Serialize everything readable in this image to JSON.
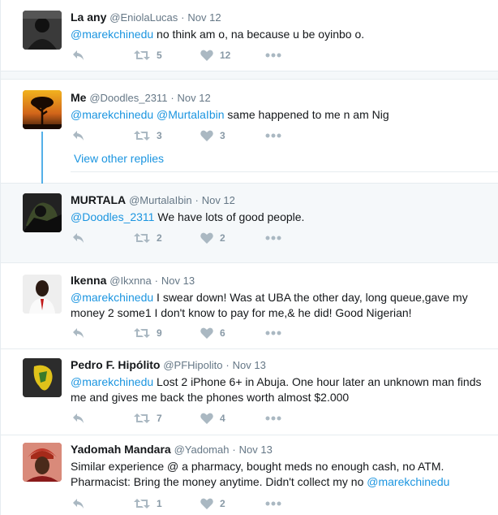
{
  "tweets": [
    {
      "name": "La any",
      "handle": "@EniolaLucas",
      "time": "Nov 12",
      "mention": "@marekchinedu",
      "text": " no think am o, na because u be oyinbo o.",
      "retweets": "5",
      "likes": "12"
    },
    {
      "name": "Me",
      "handle": "@Doodles_2311",
      "time": "Nov 12",
      "mention": "@marekchinedu @MurtalaIbin",
      "text": " same happened to me n am Nig",
      "retweets": "3",
      "likes": "3"
    },
    {
      "name": "MURTALA",
      "handle": "@MurtalaIbin",
      "time": "Nov 12",
      "mention": "@Doodles_2311",
      "text": " We have lots of good people.",
      "retweets": "2",
      "likes": "2"
    },
    {
      "name": "Ikenna",
      "handle": "@Ikxnna",
      "time": "Nov 13",
      "mention": "@marekchinedu",
      "text": " I swear down! Was at UBA the other day, long queue,gave my money 2 some1 I don't know to pay for me,& he did! Good Nigerian!",
      "retweets": "9",
      "likes": "6"
    },
    {
      "name": "Pedro F. Hipólito",
      "handle": "@PFHipolito",
      "time": "Nov 13",
      "mention": "@marekchinedu",
      "text": " Lost 2 iPhone 6+ in Abuja. One hour later an unknown man finds me and gives me back the phones worth almost $2.000",
      "retweets": "7",
      "likes": "4"
    },
    {
      "name": "Yadomah Mandara",
      "handle": "@Yadomah",
      "time": "Nov 13",
      "text_before": "Similar experience @ a pharmacy, bought meds no enough cash, no ATM. Pharmacist: Bring the money anytime. Didn't collect my no ",
      "mention": "@marekchinedu",
      "retweets": "1",
      "likes": "2"
    }
  ],
  "view_replies": "View other replies",
  "separator": "·"
}
